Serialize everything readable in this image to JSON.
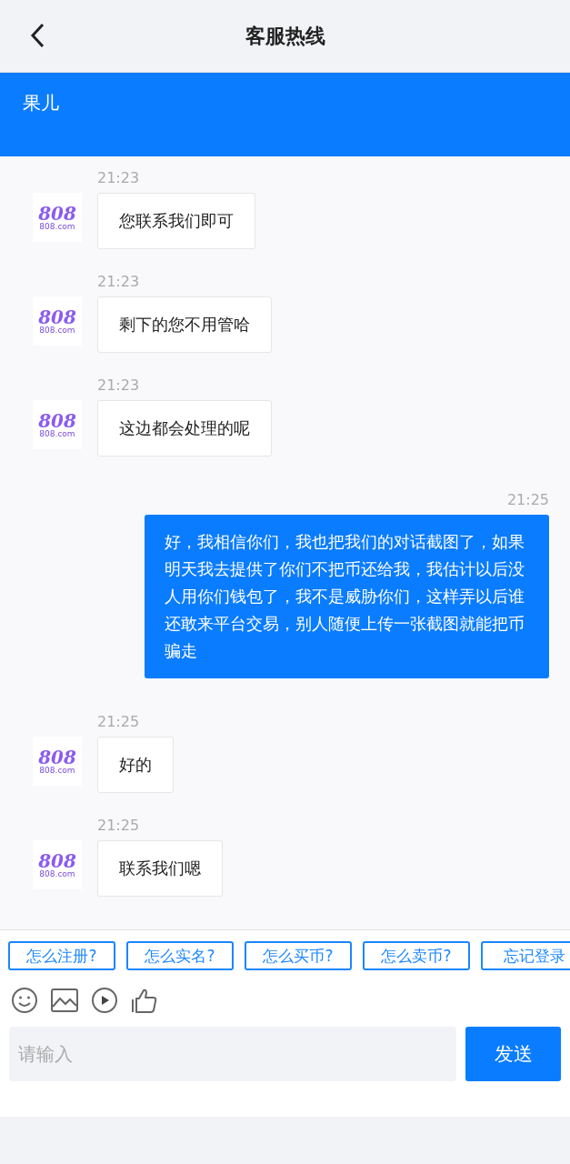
{
  "header": {
    "title": "客服热线"
  },
  "contact": {
    "name": "果儿"
  },
  "messages": [
    {
      "kind": "received",
      "time": "21:23",
      "text": "您联系我们即可",
      "avatar_mark": "808",
      "avatar_site": "808.com"
    },
    {
      "kind": "received",
      "time": "21:23",
      "text": "剩下的您不用管哈",
      "avatar_mark": "808",
      "avatar_site": "808.com"
    },
    {
      "kind": "received",
      "time": "21:23",
      "text": "这边都会处理的呢",
      "avatar_mark": "808",
      "avatar_site": "808.com"
    },
    {
      "kind": "sent",
      "time": "21:25",
      "text": "好，我相信你们，我也把我们的对话截图了，如果明天我去提供了你们不把币还给我，我估计以后没人用你们钱包了，我不是威胁你们，这样弄以后谁还敢来平台交易，别人随便上传一张截图就能把币骗走"
    },
    {
      "kind": "received",
      "time": "21:25",
      "text": "好的",
      "avatar_mark": "808",
      "avatar_site": "808.com"
    },
    {
      "kind": "received",
      "time": "21:25",
      "text": "联系我们嗯",
      "avatar_mark": "808",
      "avatar_site": "808.com"
    }
  ],
  "quick_replies": [
    "怎么注册?",
    "怎么实名?",
    "怎么买币?",
    "怎么卖币?",
    "忘记登录"
  ],
  "input": {
    "placeholder": "请输入"
  },
  "send_button": "发送"
}
